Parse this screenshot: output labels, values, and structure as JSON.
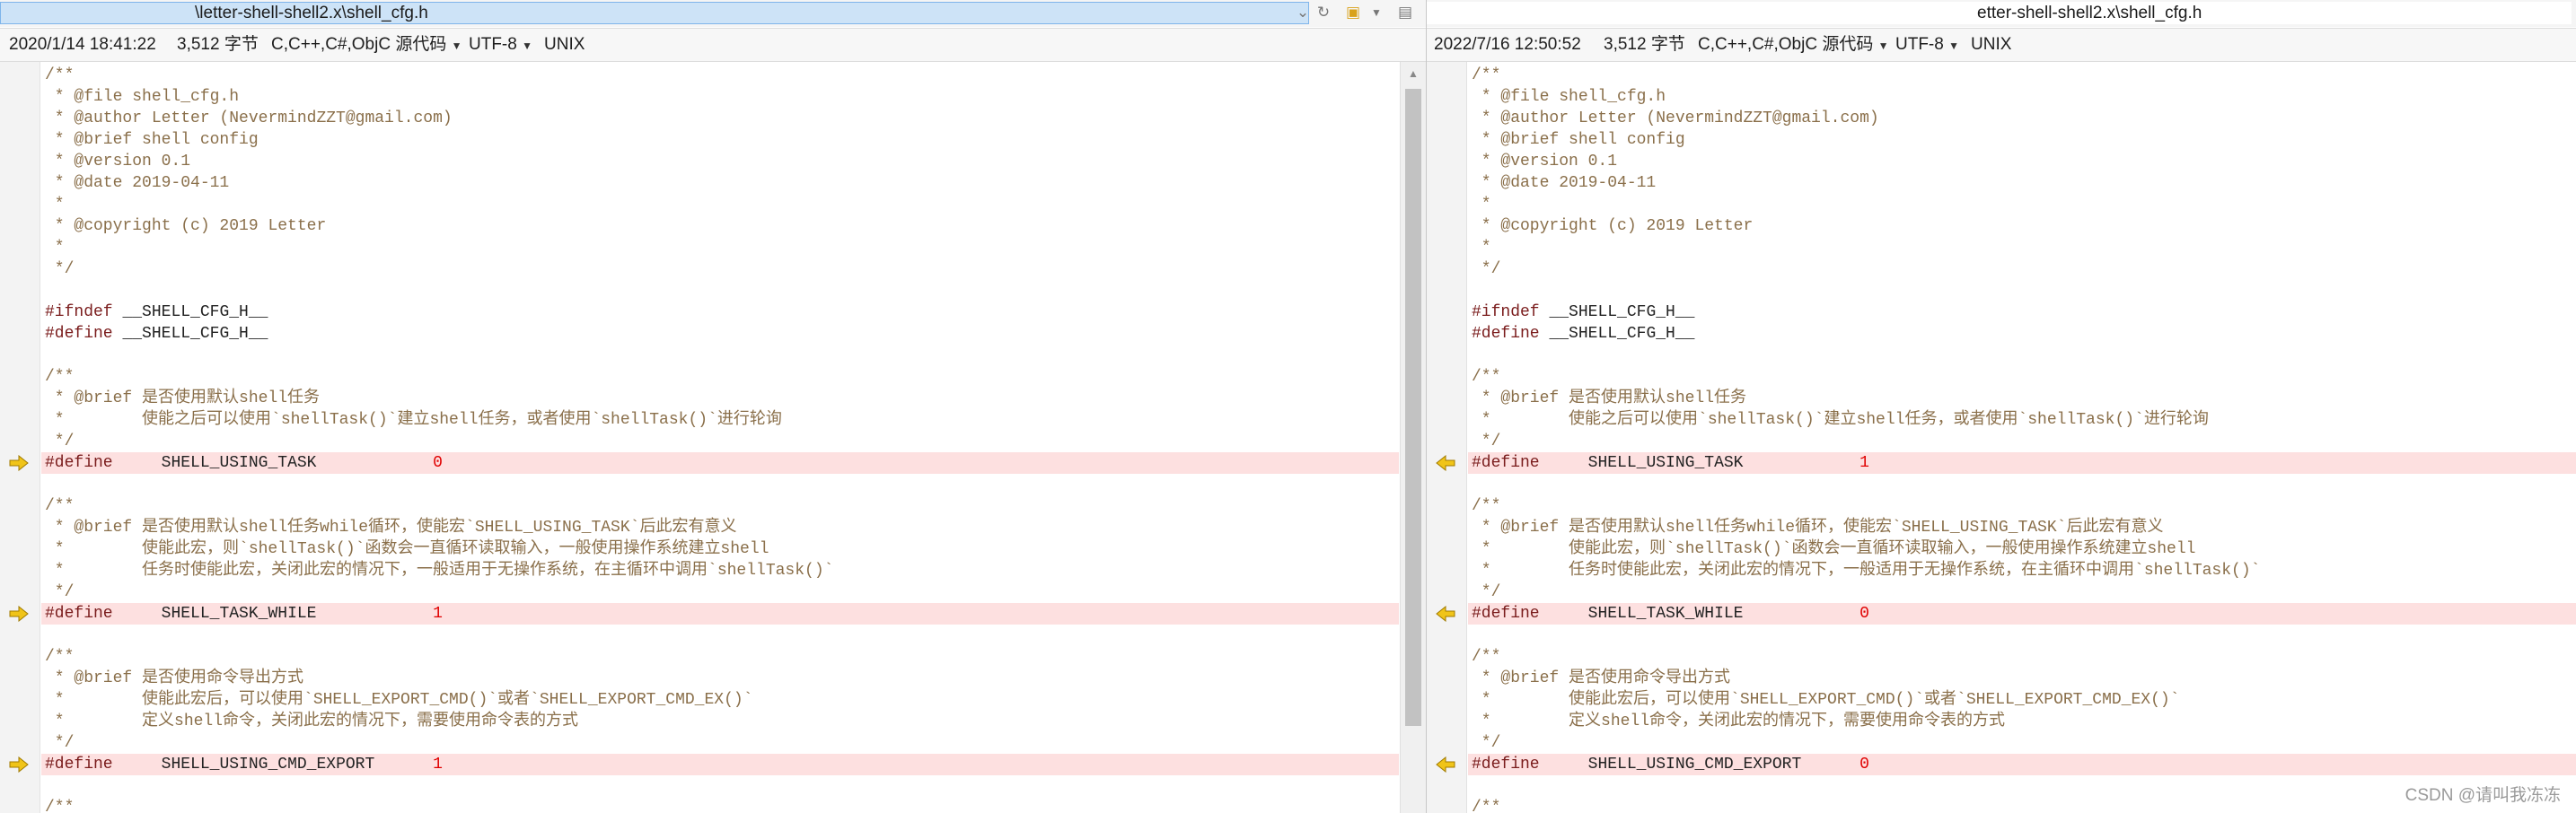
{
  "left": {
    "path": "\\letter-shell-shell2.x\\shell_cfg.h",
    "date": "2020/1/14 18:41:22",
    "size": "3,512 字节",
    "language": "C,C++,C#,ObjC 源代码",
    "encoding": "UTF-8",
    "line_ending": "UNIX",
    "lines": [
      "/**",
      " * @file shell_cfg.h",
      " * @author Letter (NevermindZZT@gmail.com)",
      " * @brief shell config",
      " * @version 0.1",
      " * @date 2019-04-11",
      " *",
      " * @copyright (c) 2019 Letter",
      " *",
      " */",
      "",
      "#ifndef __SHELL_CFG_H__",
      "#define __SHELL_CFG_H__",
      "",
      "/**",
      " * @brief 是否使用默认shell任务",
      " *        使能之后可以使用`shellTask()`建立shell任务，或者使用`shellTask()`进行轮询",
      " */",
      "#define     SHELL_USING_TASK            0",
      "",
      "/**",
      " * @brief 是否使用默认shell任务while循环，使能宏`SHELL_USING_TASK`后此宏有意义",
      " *        使能此宏，则`shellTask()`函数会一直循环读取输入，一般使用操作系统建立shell",
      " *        任务时使能此宏，关闭此宏的情况下，一般适用于无操作系统，在主循环中调用`shellTask()`",
      " */",
      "#define     SHELL_TASK_WHILE            1",
      "",
      "/**",
      " * @brief 是否使用命令导出方式",
      " *        使能此宏后，可以使用`SHELL_EXPORT_CMD()`或者`SHELL_EXPORT_CMD_EX()`",
      " *        定义shell命令，关闭此宏的情况下，需要使用命令表的方式",
      " */",
      "#define     SHELL_USING_CMD_EXPORT      1",
      "",
      "/**"
    ]
  },
  "right": {
    "path": "etter-shell-shell2.x\\shell_cfg.h",
    "date": "2022/7/16 12:50:52",
    "size": "3,512 字节",
    "language": "C,C++,C#,ObjC 源代码",
    "encoding": "UTF-8",
    "line_ending": "UNIX",
    "lines": [
      "/**",
      " * @file shell_cfg.h",
      " * @author Letter (NevermindZZT@gmail.com)",
      " * @brief shell config",
      " * @version 0.1",
      " * @date 2019-04-11",
      " *",
      " * @copyright (c) 2019 Letter",
      " *",
      " */",
      "",
      "#ifndef __SHELL_CFG_H__",
      "#define __SHELL_CFG_H__",
      "",
      "/**",
      " * @brief 是否使用默认shell任务",
      " *        使能之后可以使用`shellTask()`建立shell任务，或者使用`shellTask()`进行轮询",
      " */",
      "#define     SHELL_USING_TASK            1",
      "",
      "/**",
      " * @brief 是否使用默认shell任务while循环，使能宏`SHELL_USING_TASK`后此宏有意义",
      " *        使能此宏，则`shellTask()`函数会一直循环读取输入，一般使用操作系统建立shell",
      " *        任务时使能此宏，关闭此宏的情况下，一般适用于无操作系统，在主循环中调用`shellTask()`",
      " */",
      "#define     SHELL_TASK_WHILE            0",
      "",
      "/**",
      " * @brief 是否使用命令导出方式",
      " *        使能此宏后，可以使用`SHELL_EXPORT_CMD()`或者`SHELL_EXPORT_CMD_EX()`",
      " *        定义shell命令，关闭此宏的情况下，需要使用命令表的方式",
      " */",
      "#define     SHELL_USING_CMD_EXPORT      0",
      "",
      "/**"
    ]
  },
  "diff_lines": [
    18,
    25,
    32
  ],
  "colors": {
    "diff_bg": "#fde0e0",
    "arrow": "#f0c419",
    "comment": "#8a6f4a",
    "value": "#e00000"
  },
  "icons": {
    "nav": "swap-icon",
    "open": "folder-open-icon",
    "save": "save-icon",
    "diff_marker": "arrow-icon"
  },
  "watermark": "CSDN @请叫我冻冻"
}
